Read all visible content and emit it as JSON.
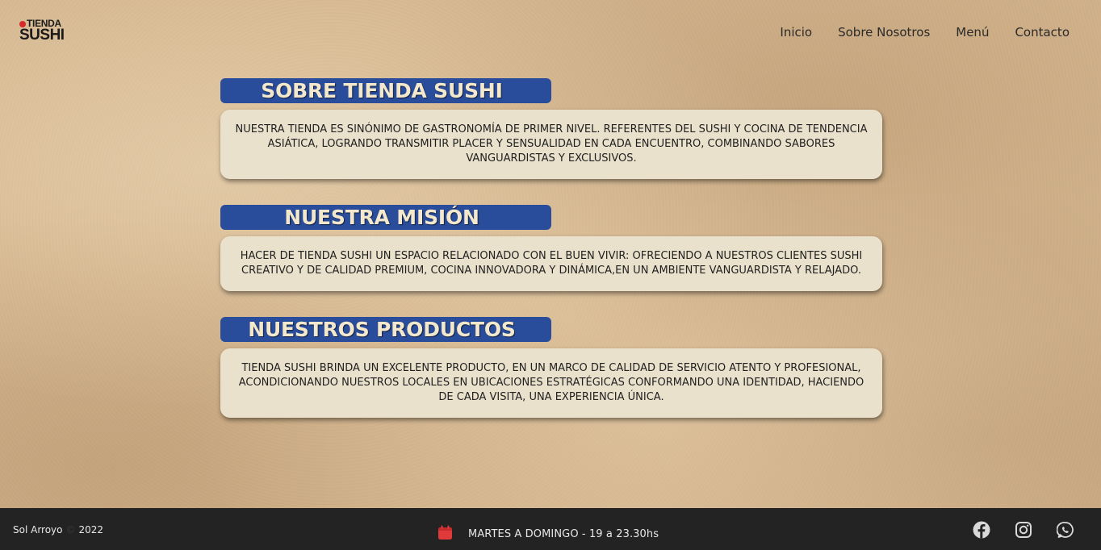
{
  "brand": {
    "logo_top": "TIENDA",
    "logo_bottom": "SUSHI"
  },
  "nav": {
    "items": [
      {
        "label": "Inicio"
      },
      {
        "label": "Sobre Nosotros"
      },
      {
        "label": "Menú"
      },
      {
        "label": "Contacto"
      }
    ]
  },
  "sections": [
    {
      "title": "SOBRE TIENDA SUSHI",
      "text": "NUESTRA TIENDA ES SINÓNIMO DE GASTRONOMÍA DE PRIMER NIVEL. REFERENTES DEL SUSHI Y COCINA DE TENDENCIA ASIÁTICA, LOGRANDO TRANSMITIR PLACER Y SENSUALIDAD EN CADA ENCUENTRO, COMBINANDO SABORES VANGUARDISTAS Y EXCLUSIVOS."
    },
    {
      "title": "NUESTRA MISIÓN",
      "text": "HACER DE TIENDA SUSHI UN ESPACIO RELACIONADO CON EL BUEN VIVIR: OFRECIENDO A NUESTROS CLIENTES SUSHI CREATIVO Y DE CALIDAD PREMIUM, COCINA INNOVADORA Y DINÁMICA,EN UN AMBIENTE VANGUARDISTA Y RELAJADO."
    },
    {
      "title": "NUESTROS PRODUCTOS",
      "text": "TIENDA SUSHI BRINDA UN EXCELENTE PRODUCTO, EN UN MARCO DE CALIDAD DE SERVICIO ATENTO Y PROFESIONAL, ACONDICIONANDO NUESTROS LOCALES EN UBICACIONES ESTRATÉGICAS CONFORMANDO UNA IDENTIDAD, HACIENDO DE CADA VISITA, UNA EXPERIENCIA ÚNICA."
    }
  ],
  "footer": {
    "author": "Sol Arroyo",
    "copyright_symbol": "©",
    "year": "2022",
    "schedule": "MARTES A DOMINGO - 19 a 23.30hs",
    "social": [
      "facebook-icon",
      "instagram-icon",
      "whatsapp-icon"
    ]
  },
  "colors": {
    "title_background": "#2a4d9b",
    "card_background": "#eae1cc",
    "footer_background": "#232323",
    "logo_accent": "#d52b2b",
    "calendar_icon": "#e03a3a"
  }
}
